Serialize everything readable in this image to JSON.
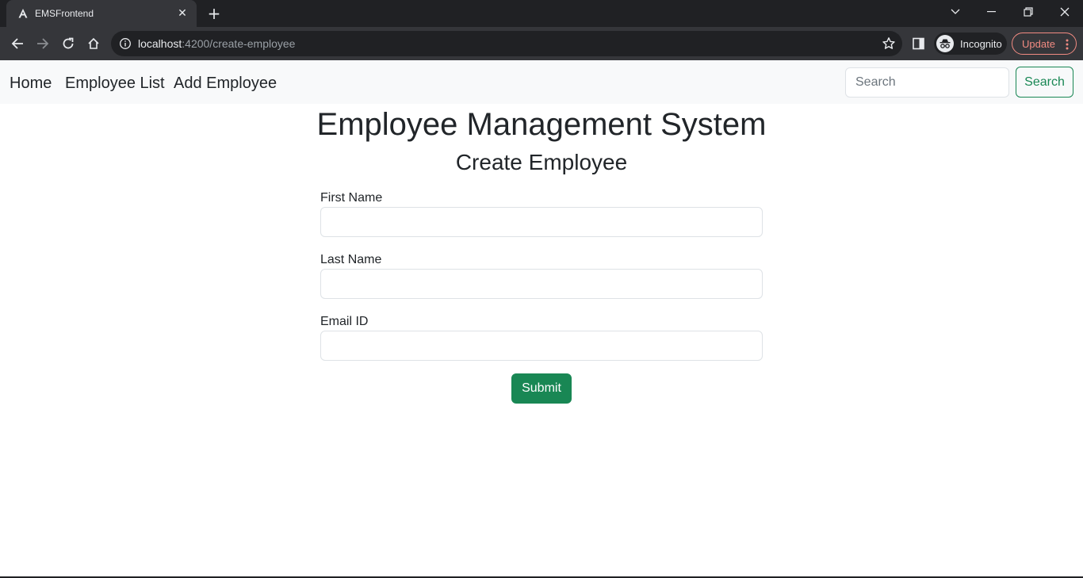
{
  "browser": {
    "tab_title": "EMSFrontend",
    "tab_close": "✕",
    "new_tab": "+",
    "url_host": "localhost",
    "url_path": ":4200/create-employee",
    "profile_label": "Incognito",
    "update_label": "Update",
    "icons": {
      "favicon": "angular-logo-icon",
      "back": "back-arrow-icon",
      "forward": "forward-arrow-icon",
      "reload": "reload-icon",
      "home": "home-icon",
      "info": "info-icon",
      "bookmark": "star-icon",
      "side_panel": "side-panel-icon",
      "incognito": "incognito-icon",
      "menu": "vertical-dots-icon",
      "tab_search": "chevron-down-icon",
      "minimize": "minimize-icon",
      "restore": "restore-icon",
      "close": "close-icon"
    }
  },
  "navbar": {
    "links": [
      "Home",
      "Employee List",
      "Add Employee"
    ],
    "search_placeholder": "Search",
    "search_button": "Search"
  },
  "main": {
    "title": "Employee Management System",
    "form_title": "Create Employee",
    "fields": [
      {
        "label": "First Name",
        "value": ""
      },
      {
        "label": "Last Name",
        "value": ""
      },
      {
        "label": "Email ID",
        "value": ""
      }
    ],
    "submit_label": "Submit"
  },
  "colors": {
    "success": "#198754",
    "navbar_bg": "#f8f9fa",
    "text": "#212529",
    "chrome_dark": "#202124",
    "chrome_tab": "#35363a"
  }
}
